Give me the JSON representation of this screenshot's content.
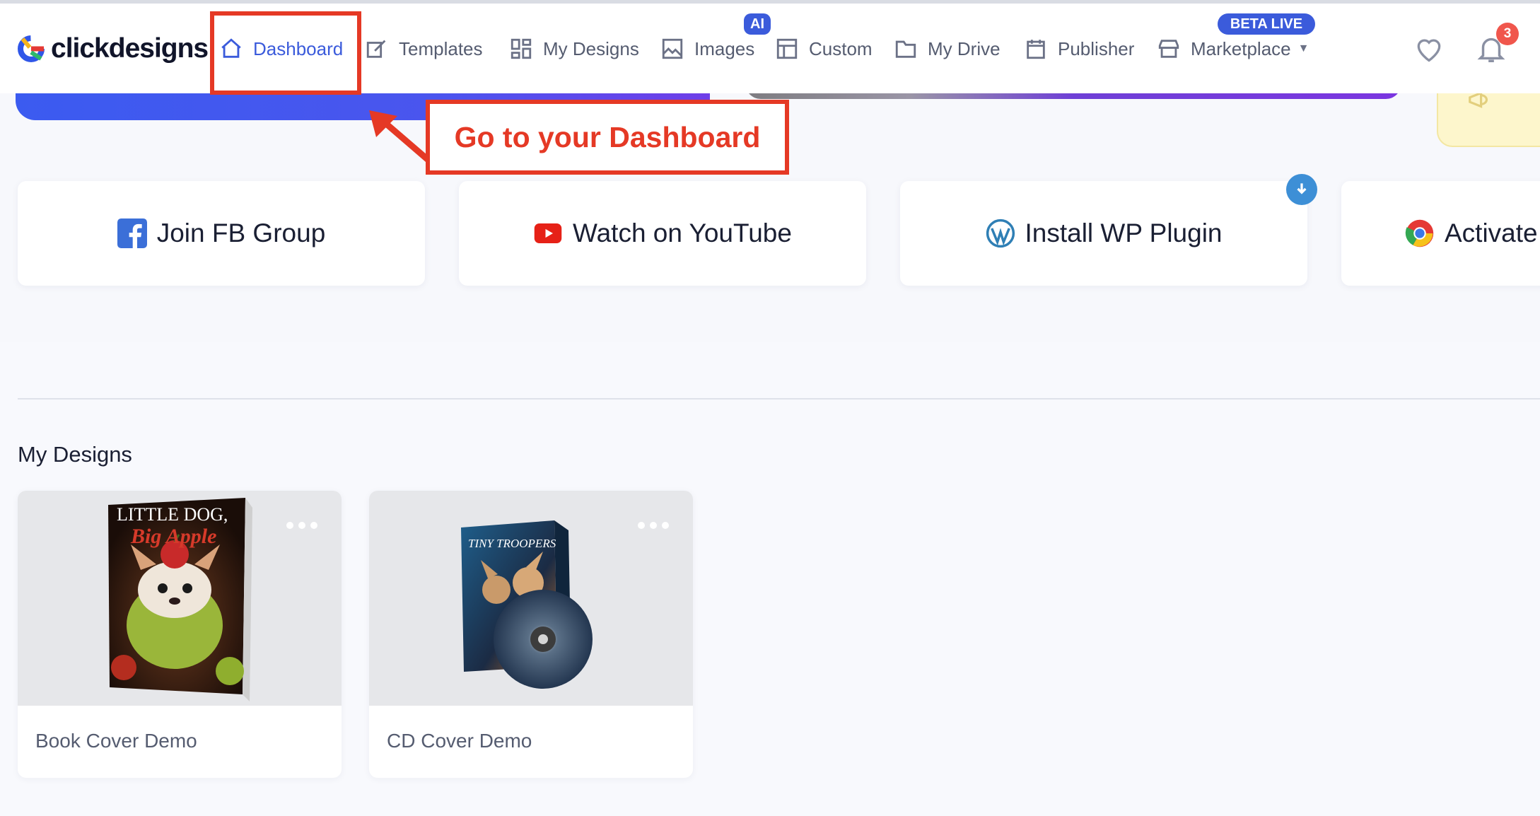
{
  "app": {
    "logo_text": "clickdesigns"
  },
  "nav": {
    "items": [
      {
        "label": "Dashboard",
        "icon": "home-icon"
      },
      {
        "label": "Templates",
        "icon": "templates-icon"
      },
      {
        "label": "My Designs",
        "icon": "grid-icon"
      },
      {
        "label": "Images",
        "icon": "image-icon",
        "badge": "AI"
      },
      {
        "label": "Custom",
        "icon": "custom-icon"
      },
      {
        "label": "My Drive",
        "icon": "folder-icon"
      },
      {
        "label": "Publisher",
        "icon": "calendar-icon"
      },
      {
        "label": "Marketplace",
        "icon": "store-icon",
        "badge": "BETA LIVE"
      }
    ],
    "notifications_count": "3"
  },
  "callout": {
    "text": "Go to your Dashboard"
  },
  "quick_actions": [
    {
      "label": "Join FB Group",
      "icon": "facebook-icon"
    },
    {
      "label": "Watch on YouTube",
      "icon": "youtube-icon"
    },
    {
      "label": "Install WP Plugin",
      "icon": "wordpress-icon"
    },
    {
      "label": "Activate",
      "icon": "chrome-icon"
    }
  ],
  "my_designs": {
    "title": "My Designs",
    "cards": [
      {
        "label": "Book Cover Demo",
        "cover_title_1": "LITTLE DOG,",
        "cover_title_2": "Big Apple"
      },
      {
        "label": "CD Cover Demo",
        "cover_title": "TINY TROOPERS"
      }
    ]
  },
  "colors": {
    "accent": "#3b5bdb",
    "highlight": "#e53925",
    "badge": "#f0564c"
  }
}
